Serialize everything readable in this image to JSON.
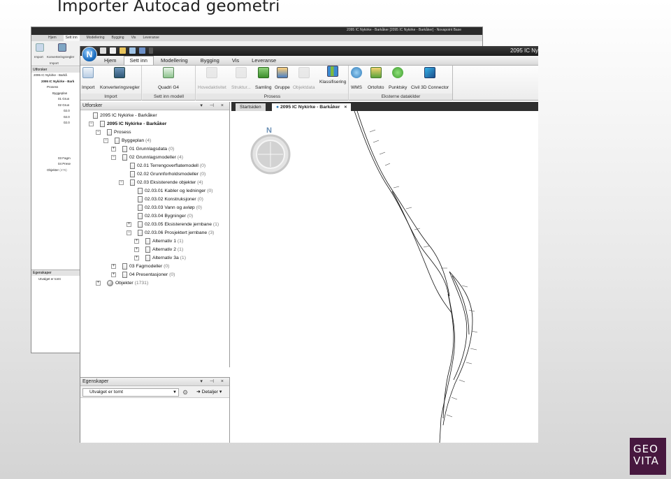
{
  "slide": {
    "title": "Importer Autocad geometri",
    "brand": [
      "GEO",
      "VITA"
    ]
  },
  "bg_window": {
    "title": "2095 IC Nykirke - Barkåker [2095 IC Nykirke - Barkåker] - Novapoint Base",
    "tabs": [
      "Hjem",
      "Sett inn",
      "Modellering",
      "Bygging",
      "Vis",
      "Leveranse"
    ],
    "buttons": [
      "Import",
      "Konverteringsregler"
    ],
    "group": "Import",
    "explorer_title": "Utforsker",
    "tree": [
      "2095 IC Nykirke - Barkå",
      "2095 IC Nykirke - Bark",
      "Prosess",
      "Byggeplan",
      "01 Grun",
      "02 Grun",
      "02.0",
      "02.0",
      "02.0",
      "03 Fagm",
      "04 Prese",
      "Objekter"
    ],
    "tree_objects_count": "(476)",
    "props_title": "Egenskaper",
    "props_value": "Utvalget er tomt"
  },
  "window": {
    "title": "2095 IC Ny",
    "app_logo": "N",
    "tabs": [
      "Hjem",
      "Sett inn",
      "Modellering",
      "Bygging",
      "Vis",
      "Leveranse"
    ],
    "active_tab": "Sett inn",
    "ribbon": {
      "import_group": {
        "label": "Import",
        "buttons": [
          "Import",
          "Konverteringsregler"
        ]
      },
      "model_group": {
        "label": "Sett inn modell",
        "buttons": [
          "Quadri G4"
        ]
      },
      "process_group": {
        "label": "Prosess",
        "buttons": [
          "Hovedaktivitet",
          "Struktur...",
          "Samling",
          "Gruppe",
          "Objektdata",
          "Klassifisering"
        ]
      },
      "external_group": {
        "label": "Eksterne datakilder",
        "buttons": [
          "WMS",
          "Ortofoto",
          "Punktsky",
          "Civil 3D Connector"
        ]
      }
    }
  },
  "explorer": {
    "title": "Utforsker",
    "rows": [
      {
        "label": "2095 IC Nykirke - Barkåker",
        "count": ""
      },
      {
        "label": "2095 IC Nykirke - Barkåker",
        "count": ""
      },
      {
        "label": "Prosess",
        "count": ""
      },
      {
        "label": "Byggeplan",
        "count": "(4)"
      },
      {
        "label": "01 Grunnlagsdata",
        "count": "(0)"
      },
      {
        "label": "02 Grunnlagsmodeller",
        "count": "(4)"
      },
      {
        "label": "02.01 Terrengoverflatemodell",
        "count": "(0)"
      },
      {
        "label": "02.02 Grunnforholdsmodeller",
        "count": "(0)"
      },
      {
        "label": "02.03 Eksisterende objekter",
        "count": "(4)"
      },
      {
        "label": "02.03.01 Kabler og ledninger",
        "count": "(0)"
      },
      {
        "label": "02.03.02 Konstruksjoner",
        "count": "(0)"
      },
      {
        "label": "02.03.03 Vann og avløp",
        "count": "(0)"
      },
      {
        "label": "02.03.04 Bygninger",
        "count": "(0)"
      },
      {
        "label": "02.03.05 Eksisterende jernbane",
        "count": "(1)"
      },
      {
        "label": "02.03.06 Prosjektert jernbane",
        "count": "(3)"
      },
      {
        "label": "Alternativ 1",
        "count": "(1)"
      },
      {
        "label": "Alternativ 2",
        "count": "(1)"
      },
      {
        "label": "Alternativ 3a",
        "count": "(1)"
      },
      {
        "label": "03 Fagmodeller",
        "count": "(0)"
      },
      {
        "label": "04 Presentasjoner",
        "count": "(0)"
      },
      {
        "label": "Objekter",
        "count": "(1731)"
      }
    ]
  },
  "properties": {
    "title": "Egenskaper",
    "selection": "Utvalget er tomt",
    "details_label": "Detaljer"
  },
  "doc_tabs": [
    {
      "label": "Startsiden"
    },
    {
      "label": "2095 IC Nykirke - Barkåker",
      "close": "×"
    }
  ],
  "map": {
    "north_label": "N"
  }
}
